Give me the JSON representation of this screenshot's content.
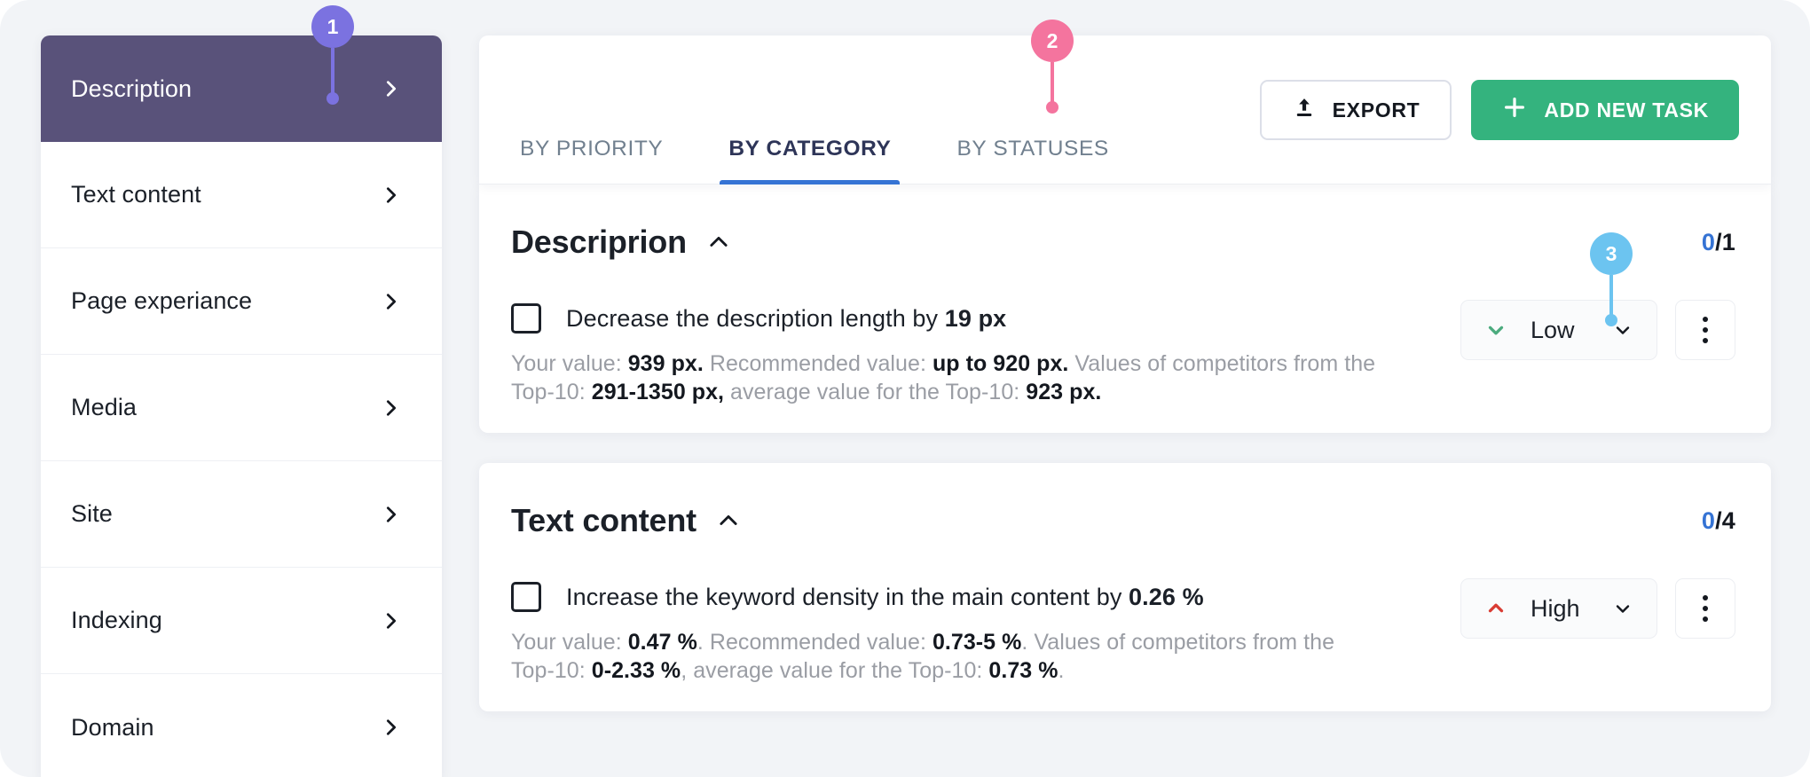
{
  "sidebar": {
    "items": [
      {
        "label": "Description",
        "active": true,
        "icon": "chevron-right-icon"
      },
      {
        "label": "Text content",
        "active": false,
        "icon": "chevron-right-icon"
      },
      {
        "label": "Page experiance",
        "active": false,
        "icon": "chevron-right-icon"
      },
      {
        "label": "Media",
        "active": false,
        "icon": "chevron-right-icon"
      },
      {
        "label": "Site",
        "active": false,
        "icon": "chevron-right-icon"
      },
      {
        "label": "Indexing",
        "active": false,
        "icon": "chevron-right-icon"
      },
      {
        "label": "Domain",
        "active": false,
        "icon": "chevron-right-icon"
      }
    ]
  },
  "toolbar": {
    "tabs": [
      {
        "label": "BY PRIORITY",
        "active": false
      },
      {
        "label": "BY CATEGORY",
        "active": true
      },
      {
        "label": "BY STATUSES",
        "active": false
      }
    ],
    "export_label": "EXPORT",
    "export_icon": "upload-icon",
    "add_task_label": "ADD NEW TASK",
    "add_task_icon": "plus-icon"
  },
  "sections": [
    {
      "title": "Descriprion",
      "collapse_icon": "chevron-up-icon",
      "count_done": "0",
      "count_total": "/1",
      "tasks": [
        {
          "checked": false,
          "title_plain": "Decrease the description length by ",
          "title_bold": "19 px",
          "desc_parts": [
            {
              "t": "Your value: ",
              "b": false
            },
            {
              "t": "939 px.",
              "b": true
            },
            {
              "t": " Recommended value: ",
              "b": false
            },
            {
              "t": "up to 920 px.",
              "b": true
            },
            {
              "t": " Values of competitors from the Top-10: ",
              "b": false
            },
            {
              "t": "291-1350 px,",
              "b": true
            },
            {
              "t": " average value for the Top-10: ",
              "b": false
            },
            {
              "t": "923 px.",
              "b": true
            }
          ],
          "priority": "Low",
          "priority_icon": "chevron-down-icon",
          "priority_color": "#4bab7e",
          "caret_icon": "chevron-down-icon",
          "menu_icon": "kebab-menu-icon"
        }
      ]
    },
    {
      "title": "Text content",
      "collapse_icon": "chevron-up-icon",
      "count_done": "0",
      "count_total": "/4",
      "tasks": [
        {
          "checked": false,
          "title_plain": "Increase the keyword density in the main content by ",
          "title_bold": "0.26 %",
          "desc_parts": [
            {
              "t": "Your value: ",
              "b": false
            },
            {
              "t": "0.47 %",
              "b": true
            },
            {
              "t": ". Recommended value: ",
              "b": false
            },
            {
              "t": "0.73-5 %",
              "b": true
            },
            {
              "t": ". Values of competitors from the Top-10: ",
              "b": false
            },
            {
              "t": "0-2.33 %",
              "b": true
            },
            {
              "t": ", average value for the Top-10: ",
              "b": false
            },
            {
              "t": "0.73 %",
              "b": true
            },
            {
              "t": ".",
              "b": false
            }
          ],
          "priority": "High",
          "priority_icon": "chevron-up-icon",
          "priority_color": "#d93c33",
          "caret_icon": "chevron-down-icon",
          "menu_icon": "kebab-menu-icon"
        }
      ]
    }
  ],
  "markers": [
    {
      "number": "1",
      "color": "#7b72e0"
    },
    {
      "number": "2",
      "color": "#f4749e"
    },
    {
      "number": "3",
      "color": "#6cc4f0"
    }
  ],
  "colors": {
    "accent_blue": "#3573d4",
    "green": "#34b37e",
    "sidebar_active": "#59527a",
    "background": "#f2f4f7"
  }
}
